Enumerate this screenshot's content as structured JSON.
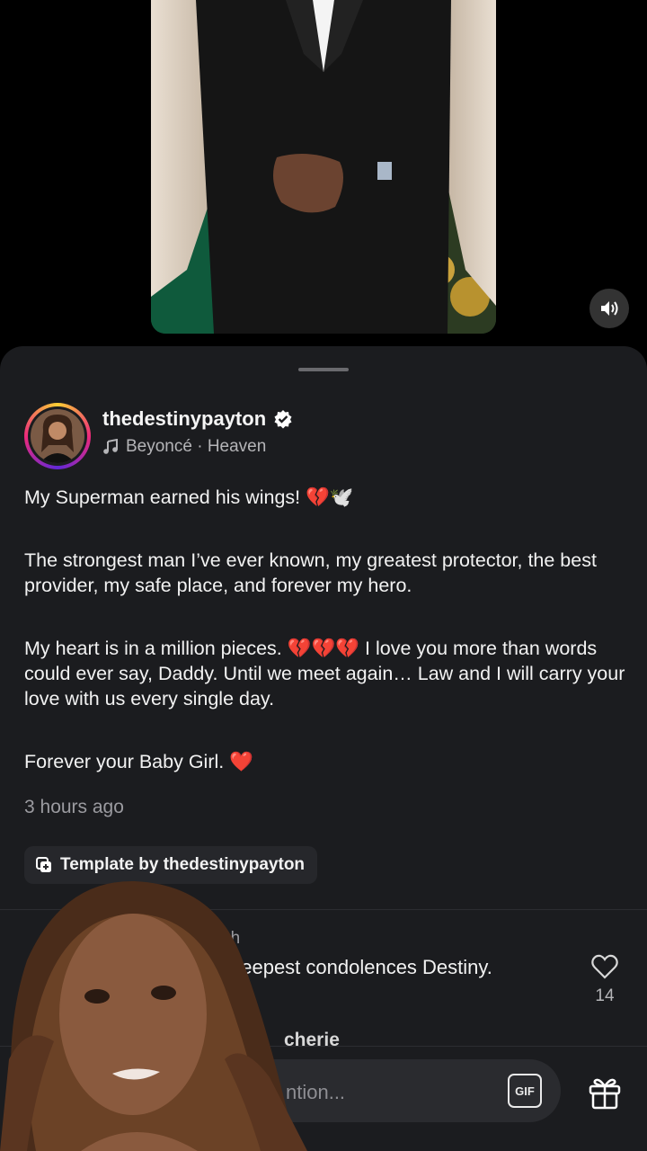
{
  "post": {
    "username": "thedestinypayton",
    "verified": true,
    "music": "Beyoncé · Heaven",
    "caption": {
      "line1": "My Superman earned his wings! 💔🕊️",
      "line2": "The strongest man I’ve ever known, my greatest protector, the best provider, my safe place, and forever my hero.",
      "line3": "My heart is in a million pieces. 💔💔💔 I love you more than words could ever say, Daddy. Until we meet again… Law and I will carry your love with us every single day.",
      "line4": "Forever your Baby Girl. ❤️"
    },
    "timestamp": "3 hours ago",
    "template_label": "Template by thedestinypayton"
  },
  "comments": {
    "first": {
      "time": "2h",
      "text": "deepest condolences Destiny.",
      "likes": "14"
    },
    "second_partial_name": "cherie"
  },
  "input": {
    "placeholder": "ntion...",
    "gif_label": "GIF"
  },
  "colors": {
    "sheet_bg": "#1b1c1f",
    "text": "#f2f2f2",
    "muted": "#9b9ba0",
    "verified": "#ffffff"
  },
  "icons": [
    "sound-on-icon",
    "music-note-icon",
    "verified-badge-icon",
    "template-icon",
    "heart-outline-icon",
    "gift-icon"
  ]
}
